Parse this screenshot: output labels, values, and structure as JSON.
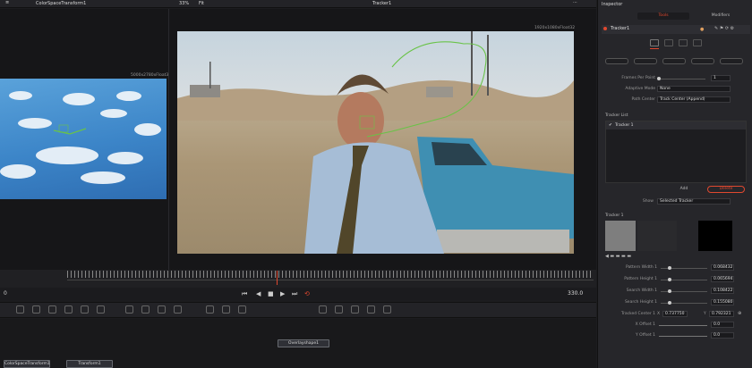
{
  "topbar": {
    "node_name": "ColorSpaceTransform1",
    "zoom": "33%",
    "fit": "Fit",
    "title": "Tracker1"
  },
  "viewer_left": {
    "resolution": "5000x2780xFloat32"
  },
  "viewer_right": {
    "resolution": "1920x1080xFloat32"
  },
  "transport": {
    "current_frame": "0",
    "end_frame": "330.0"
  },
  "nodes": [
    {
      "label": "ColorSpaceTransform1"
    },
    {
      "label": "Transform1"
    },
    {
      "label": "Overlayshape1"
    }
  ],
  "inspector": {
    "title": "Inspector",
    "tabs": {
      "tools": "Tools",
      "modifiers": "Modifiers"
    },
    "node_name": "Tracker1",
    "frames_per_point_label": "Frames Per Point",
    "frames_per_point_value": "1",
    "adaptive_mode_label": "Adaptive Mode",
    "adaptive_mode_value": "None",
    "path_center_label": "Path Center",
    "path_center_value": "Track Center (Append)",
    "tracker_list_label": "Tracker List",
    "tracker_item": "Tracker 1",
    "add_label": "Add",
    "delete_label": "Delete",
    "show_label": "Show",
    "show_value": "Selected Tracker",
    "tracker_section": "Tracker 1",
    "params": [
      {
        "label": "Pattern Width 1",
        "value": "0.068432"
      },
      {
        "label": "Pattern Height 1",
        "value": "0.065694"
      },
      {
        "label": "Search Width 1",
        "value": "0.108422"
      },
      {
        "label": "Search Height 1",
        "value": "0.155080"
      }
    ],
    "tracked_center_label": "Tracked Center 1",
    "tracked_center_x": "0.737750",
    "tracked_center_y": "0.792321",
    "x_offset_label": "X Offset 1",
    "x_offset_value": "0.0",
    "y_offset_label": "Y Offset 1",
    "y_offset_value": "0.0"
  },
  "colors": {
    "accent": "#e0482f",
    "panel": "#26262a",
    "tracker_path": "#69c347"
  }
}
